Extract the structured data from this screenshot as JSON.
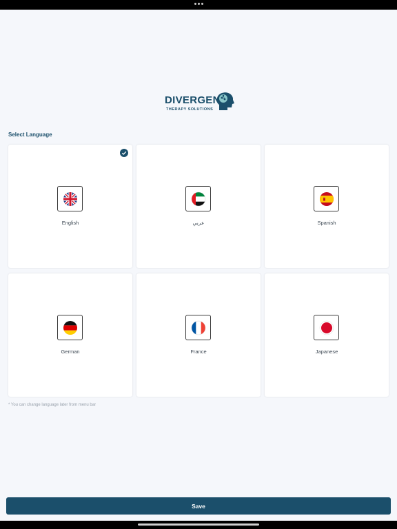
{
  "logo": {
    "brand": "DIVERGENT",
    "tagline": "THERAPY SOLUTIONS"
  },
  "section_title": "Select Language",
  "languages": [
    {
      "label": "English",
      "flag": "uk-flag-icon",
      "selected": true
    },
    {
      "label": "عربي",
      "flag": "uae-flag-icon",
      "selected": false
    },
    {
      "label": "Spanish",
      "flag": "spain-flag-icon",
      "selected": false
    },
    {
      "label": "German",
      "flag": "germany-flag-icon",
      "selected": false
    },
    {
      "label": "France",
      "flag": "france-flag-icon",
      "selected": false
    },
    {
      "label": "Japanese",
      "flag": "japan-flag-icon",
      "selected": false
    }
  ],
  "note": "* You can change language later from menu bar",
  "save_label": "Save",
  "colors": {
    "primary": "#1b4f6b",
    "background": "#f5f7fb",
    "card": "#ffffff"
  }
}
